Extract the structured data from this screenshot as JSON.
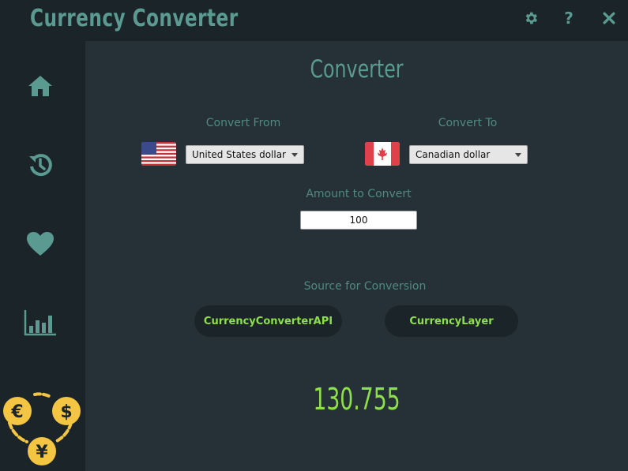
{
  "app": {
    "title": "Currency Converter"
  },
  "titlebar": {
    "settings_icon": "gear-icon",
    "help_label": "?",
    "close_icon": "close-icon"
  },
  "sidebar": {
    "items": [
      {
        "icon": "home-icon"
      },
      {
        "icon": "history-icon"
      },
      {
        "icon": "heart-icon"
      },
      {
        "icon": "bar-chart-icon"
      }
    ],
    "logo_icon": "currency-exchange-logo"
  },
  "main": {
    "title": "Converter",
    "from": {
      "label": "Convert From",
      "flag": "us-flag-icon",
      "value": "United States dollar"
    },
    "to": {
      "label": "Convert To",
      "flag": "canada-flag-icon",
      "value": "Canadian dollar"
    },
    "amount": {
      "label": "Amount to Convert",
      "value": "100"
    },
    "source": {
      "label": "Source for Conversion",
      "options": [
        "CurrencyConverterAPI",
        "CurrencyLayer"
      ]
    },
    "result": "130.755"
  },
  "colors": {
    "accent": "#5b9a91",
    "result": "#8ee04a",
    "sidebar_bg": "#1b2428",
    "main_bg": "#253136"
  }
}
